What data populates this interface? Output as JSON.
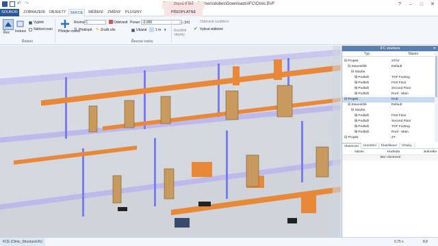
{
  "window": {
    "title": "BIMvision 2.27.5 - C:\\Users\\dobes\\Downloads\\IFC\\Clinic.BVF",
    "trial_label": "Zbýva 8 dní"
  },
  "ribbon": {
    "tabs": [
      "SOUBOR",
      "ZOBRAZENÍ",
      "OBJEKTY",
      "SEKCE",
      "MĚŘENÍ",
      "ZMĚNY",
      "PLUGINY",
      "PŘEDPLATNÉ"
    ],
    "active_tab": "SEKCE",
    "section": {
      "rez_label": "Řez",
      "instuce_label": "Instuce",
      "vyplnit_label": "Vyplnit",
      "nahled_label": "Náhled rovin",
      "group_label": "Řešení"
    },
    "planes": {
      "pridejte_label": "Přidejte rovinu",
      "rovina_label": "Rovina",
      "rovina_value": "C",
      "odstranit_label": "Odstranit",
      "preklopit_label": "Překlopit",
      "zrusit_label": "Zrušit vše",
      "posun_label": "Posun",
      "posun_value": "-0,000",
      "unit_label": "[m]",
      "ukazat_label": "Ukázat",
      "size_value": "1 m",
      "group_label": "Řezové roviny"
    },
    "objects": {
      "rozdelit_label": "Rozdělit objekty",
      "odstranit_rozdeleni": "Odstranit rozdělení",
      "vybrat_viditelne": "Vybrat viditelné"
    }
  },
  "ifc_panel": {
    "title": "IFC struktura",
    "col_type": "Typ",
    "col_name": "Název",
    "rows": [
      {
        "type": "Projekt",
        "name": "STAV"
      },
      {
        "type": "Staveniště",
        "name": "Default"
      },
      {
        "type": "Stavba",
        "name": ""
      },
      {
        "type": "Podlaží",
        "name": "TOF Footing"
      },
      {
        "type": "Podlaží",
        "name": "First Floor"
      },
      {
        "type": "Podlaží",
        "name": "Second Floor"
      },
      {
        "type": "Podlaží",
        "name": "Roof - Main"
      },
      {
        "type": "Projekt",
        "name": "KCE"
      },
      {
        "type": "Staveniště",
        "name": "Default"
      },
      {
        "type": "Stavba",
        "name": ""
      },
      {
        "type": "Podlaží",
        "name": "First Floor"
      },
      {
        "type": "Podlaží",
        "name": "Second Floor"
      },
      {
        "type": "Podlaží",
        "name": "TOF Footing"
      },
      {
        "type": "Podlaží",
        "name": "Roof - Main"
      },
      {
        "type": "Projekt",
        "name": "ZT"
      }
    ]
  },
  "properties_panel": {
    "tabs": [
      "Vlastnosti",
      "Umístění",
      "Klasifikace",
      "Vztahy"
    ],
    "col_name": "Název",
    "col_value": "Hodnota",
    "col_unit": "Jednotka",
    "empty_text": "Bez vlastností"
  },
  "status_bar": {
    "file": "KCE (Clinic_Structural.ifc)",
    "zoom": "0,75 s",
    "value": "8,8"
  },
  "colors": {
    "accent": "#2b5797",
    "duct_orange": "#e8893a",
    "section_edge": "#7b7bf0",
    "wall_gray": "#d9dce0",
    "door_brown": "#c89a5e",
    "trial_bg": "#f7e4e4"
  }
}
